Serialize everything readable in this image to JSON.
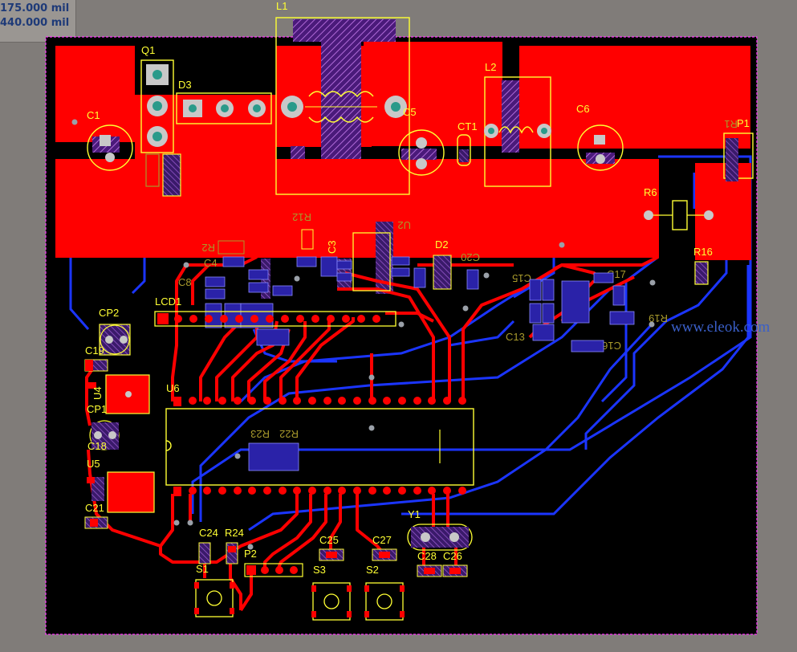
{
  "coordinates": {
    "x": "175.000 mil",
    "y": "440.000 mil"
  },
  "watermark": "www.eleok.com",
  "designators": {
    "L1": "L1",
    "Q1": "Q1",
    "D3": "D3",
    "C1": "C1",
    "L2": "L2",
    "C6": "C6",
    "CT1": "CT1",
    "P1": "P1",
    "R1": "R1",
    "R6": "R6",
    "R16": "R16",
    "R12": "R12",
    "C3": "C3",
    "D2": "D2",
    "C20": "C20",
    "R2": "R2",
    "LCD1": "LCD1",
    "CP2": "CP2",
    "C19": "C19",
    "U4": "U4",
    "CP1": "CP1",
    "C18": "C18",
    "U5": "U5",
    "C21": "C21",
    "U6": "U6",
    "C13": "C13",
    "C16": "C16",
    "R19": "R19",
    "C17": "C17",
    "Y1": "Y1",
    "C28": "C28",
    "C26": "C26",
    "C25": "C25",
    "C27": "C27",
    "C24": "C24",
    "R24": "R24",
    "P2": "P2",
    "S1": "S1",
    "S3": "S3",
    "S2": "S2",
    "R22": "R22",
    "R23": "R23",
    "C4": "C4",
    "C8": "C8",
    "C15": "C15",
    "C5": "C5",
    "U2": "U2"
  },
  "colors": {
    "background": "#807c79",
    "board": "#000000",
    "top_copper": "#ff0000",
    "bottom_copper": "#1b35ff",
    "silkscreen": "#ffff33",
    "outline": "#ff33ff",
    "pad_metal": "#c8c8c8",
    "via": "#9aa0a8"
  }
}
